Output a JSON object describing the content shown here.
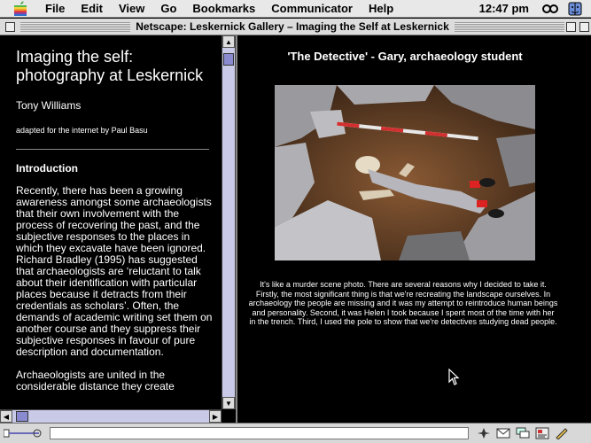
{
  "menubar": {
    "items": [
      "File",
      "Edit",
      "View",
      "Go",
      "Bookmarks",
      "Communicator",
      "Help"
    ],
    "clock": "12:47 pm",
    "icons": [
      "apple-icon",
      "control-strip-icon",
      "finder-app-icon"
    ]
  },
  "window": {
    "title": "Netscape: Leskernick Gallery – Imaging the Self at Leskernick"
  },
  "left": {
    "title": "Imaging the self: photography at Leskernick",
    "author": "Tony Williams",
    "adapted": "adapted for the internet by Paul Basu",
    "heading": "Introduction",
    "paragraphs": [
      "Recently, there has been a growing awareness amongst some archaeologists that their own involvement with the process of recovering the past, and the subjective responses to the places in which they excavate have been ignored. Richard Bradley (1995) has suggested that archaeologists are ‘reluctant to talk about their identification with particular places because it detracts from their credentials as scholars’. Often, the demands of academic writing set them on another course and they suppress their subjective responses in favour of pure description and documentation.",
      "Archaeologists are united in the considerable distance they create"
    ]
  },
  "right": {
    "caption_title": "'The Detective' - Gary, archaeology student",
    "caption_text": "It's like a murder scene photo. There are several reasons why I decided to take it. Firstly, the most significant thing is that we're recreating the landscape ourselves. In archaeology the people are missing and it was my attempt to reintroduce human beings and personality. Second, it was Helen I took because I spent most of the time with her in the trench. Third, I used the pole to show that we're detectives studying dead people."
  },
  "colors": {
    "page_bg": "#000000",
    "text": "#ffffff",
    "scrollbar_track": "#c9c9e8",
    "scrollbar_thumb": "#8a8ad0"
  }
}
